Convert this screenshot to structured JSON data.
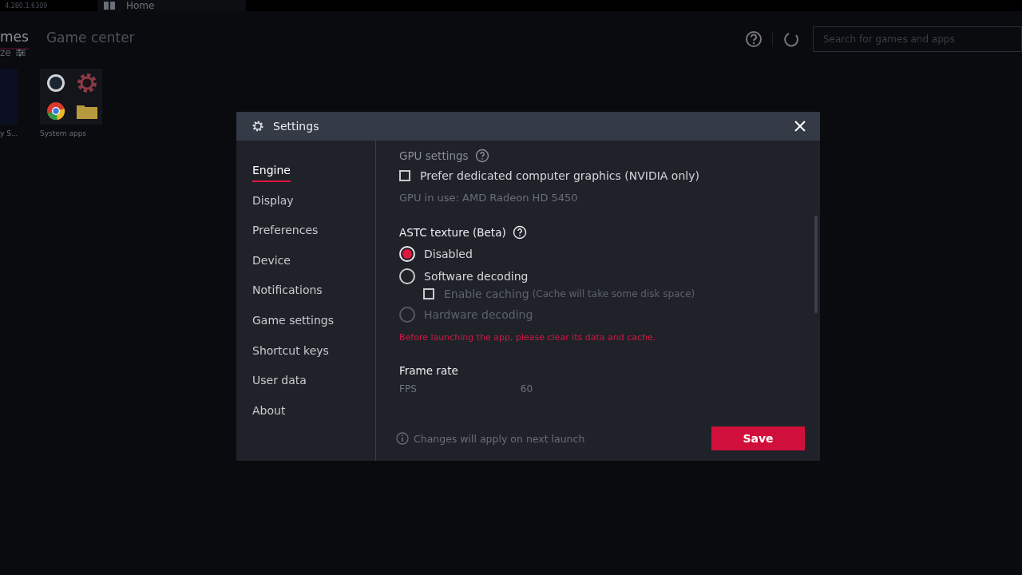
{
  "app": {
    "version": "4.280.1.6309",
    "home_tab": "Home",
    "tabs": [
      {
        "label": "mes",
        "selected": true
      },
      {
        "label": "Game center",
        "selected": false
      }
    ],
    "customize_label": "ze",
    "search": {
      "placeholder": "Search for games and apps"
    },
    "apps": [
      {
        "label": "y S..."
      },
      {
        "label": "System apps"
      }
    ]
  },
  "dialog": {
    "title": "Settings",
    "sidebar": [
      {
        "label": "Engine",
        "selected": true
      },
      {
        "label": "Display",
        "selected": false
      },
      {
        "label": "Preferences",
        "selected": false
      },
      {
        "label": "Device",
        "selected": false
      },
      {
        "label": "Notifications",
        "selected": false
      },
      {
        "label": "Game settings",
        "selected": false
      },
      {
        "label": "Shortcut keys",
        "selected": false
      },
      {
        "label": "User data",
        "selected": false
      },
      {
        "label": "About",
        "selected": false
      }
    ],
    "gpu": {
      "heading": "GPU settings",
      "option": {
        "label": "Prefer dedicated computer graphics (NVIDIA only)",
        "checked": false
      },
      "in_use": "GPU in use: AMD Radeon HD 5450"
    },
    "astc": {
      "heading": "ASTC texture (Beta)",
      "options": [
        {
          "label": "Disabled",
          "selected": true,
          "disabled": false
        },
        {
          "label": "Software decoding",
          "selected": false,
          "disabled": false,
          "sub_option": {
            "label": "Enable caching",
            "note": "(Cache will take some disk space)",
            "checked": false
          }
        },
        {
          "label": "Hardware decoding",
          "selected": false,
          "disabled": true
        }
      ],
      "warning": "Before launching the app, please clear its data and cache."
    },
    "frame_rate": {
      "heading": "Frame rate",
      "label": "FPS",
      "value": "60"
    },
    "footer_note": "Changes will apply on next launch",
    "save_button": "Save"
  }
}
